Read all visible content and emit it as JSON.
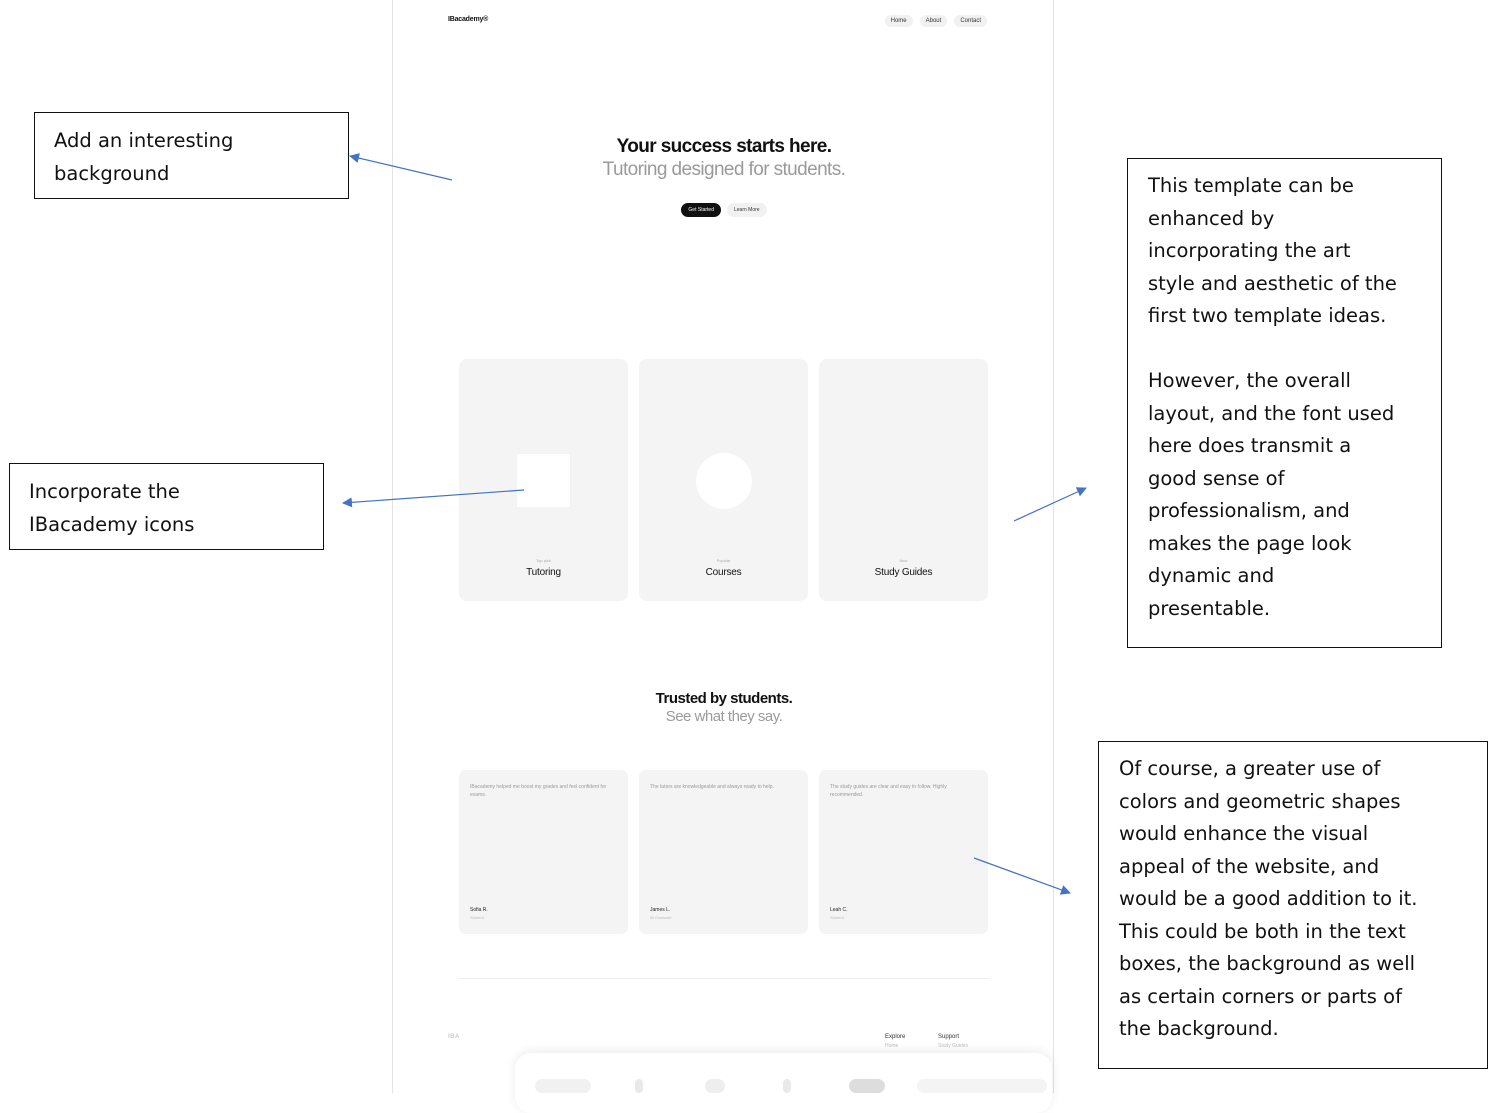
{
  "mockup": {
    "logo": "IBacademy®",
    "nav": [
      "Home",
      "About",
      "Contact"
    ],
    "hero": {
      "title": "Your success starts here.",
      "subtitle": "Tutoring designed for students.",
      "primary_button": "Get Started",
      "secondary_button": "Learn More"
    },
    "cards": [
      {
        "eyebrow": "Top pick",
        "title": "Tutoring",
        "shape": "square"
      },
      {
        "eyebrow": "Popular",
        "title": "Courses",
        "shape": "circle"
      },
      {
        "eyebrow": "New",
        "title": "Study Guides",
        "shape": "none"
      }
    ],
    "trusted": {
      "title": "Trusted by students.",
      "subtitle": "See what they say."
    },
    "testimonials": [
      {
        "quote": "IBacademy helped me boost my grades and feel confident for exams.",
        "name": "Sofia R.",
        "role": "Student"
      },
      {
        "quote": "The tutors are knowledgeable and always ready to help.",
        "name": "James L.",
        "role": "IB Graduate"
      },
      {
        "quote": "The study guides are clear and easy to follow. Highly recommended.",
        "name": "Leah C.",
        "role": "Student"
      }
    ],
    "footer": {
      "logo": "IBA",
      "columns": [
        {
          "title": "Explore",
          "item": "Home"
        },
        {
          "title": "Support",
          "item": "Study Guides"
        }
      ]
    }
  },
  "annotations": {
    "background": [
      "Add an interesting",
      "background"
    ],
    "icons": [
      "Incorporate the",
      "IBacademy icons"
    ],
    "aesthetic": [
      "This template can be",
      "enhanced by",
      "incorporating the art",
      "style and aesthetic of the",
      "first two template ideas.",
      "",
      "However, the overall",
      "layout, and the font used",
      "here does transmit a",
      "good sense of",
      "professionalism, and",
      "makes the page look",
      "dynamic and",
      "presentable."
    ],
    "colors": [
      "Of course, a greater use of",
      "colors and geometric shapes",
      "would enhance the visual",
      "appeal of the website, and",
      "would be a good addition to it.",
      "This could be both in the text",
      "boxes, the background as well",
      "as certain corners or parts of",
      "the background."
    ]
  },
  "colors": {
    "arrow": "#4472c4",
    "card_bg": "#f4f4f4",
    "muted_text": "#9a9a9a"
  }
}
